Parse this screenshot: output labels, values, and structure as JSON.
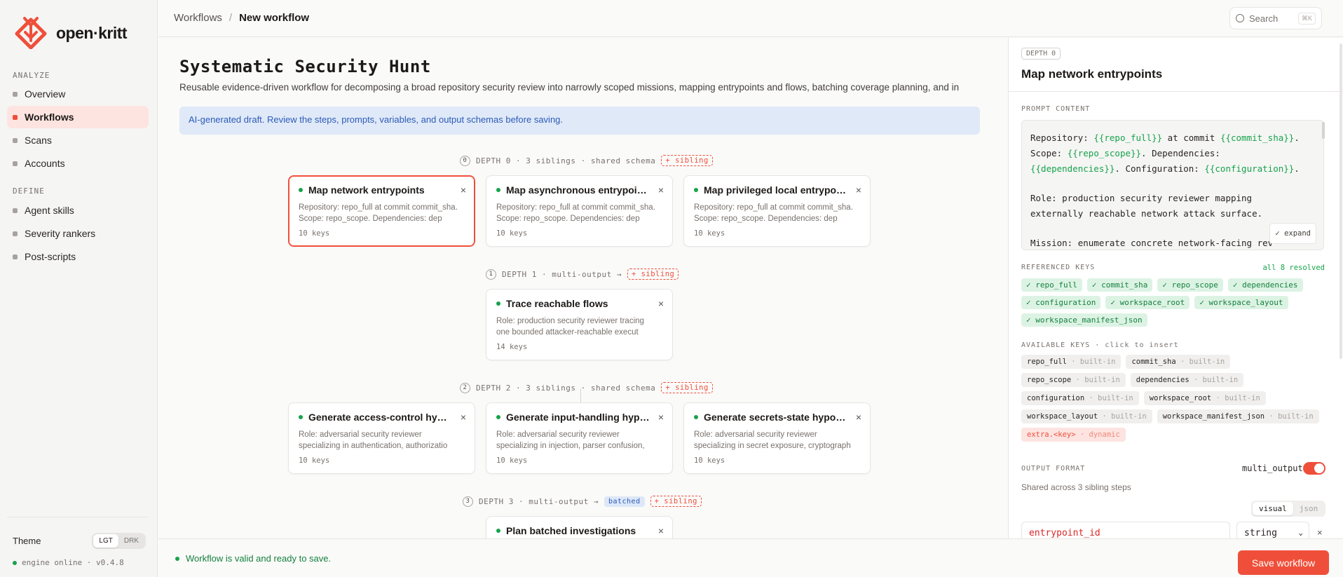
{
  "app": {
    "name": "open·kritt",
    "brand_color": "#ef4f3a"
  },
  "sidebar": {
    "analyze_label": "ANALYZE",
    "analyze_items": [
      {
        "label": "Overview"
      },
      {
        "label": "Workflows",
        "active": true
      },
      {
        "label": "Scans"
      },
      {
        "label": "Accounts"
      }
    ],
    "define_label": "DEFINE",
    "define_items": [
      {
        "label": "Agent skills"
      },
      {
        "label": "Severity rankers"
      },
      {
        "label": "Post-scripts"
      }
    ],
    "theme_label": "Theme",
    "theme_light": "LGT",
    "theme_dark": "DRK",
    "engine_status": "engine online · v0.4.8"
  },
  "topbar": {
    "breadcrumb_root": "Workflows",
    "breadcrumb_sep": "/",
    "breadcrumb_current": "New workflow",
    "search_placeholder": "Search",
    "search_shortcut": "⌘K"
  },
  "main": {
    "title": "Systematic Security Hunt",
    "subtitle": "Reusable evidence-driven workflow for decomposing a broad repository security review into narrowly scoped missions, mapping entrypoints and flows, batching coverage planning, and in",
    "banner": "AI-generated draft. Review the steps, prompts, variables, and output schemas before saving.",
    "depths": [
      {
        "num": "0",
        "label": "DEPTH 0 · 3 siblings · shared schema",
        "sibling": "+ sibling",
        "cards": [
          {
            "title": "Map network entrypoints",
            "desc1": "Repository: repo_full at commit commit_sha.",
            "desc2": "Scope: repo_scope. Dependencies: dep",
            "keys": "10 keys"
          },
          {
            "title": "Map asynchronous entrypoints",
            "desc1": "Repository: repo_full at commit commit_sha.",
            "desc2": "Scope: repo_scope. Dependencies: dep",
            "keys": "10 keys"
          },
          {
            "title": "Map privileged local entrypoin...",
            "desc1": "Repository: repo_full at commit commit_sha.",
            "desc2": "Scope: repo_scope. Dependencies: dep",
            "keys": "10 keys"
          }
        ]
      },
      {
        "num": "1",
        "label": "DEPTH 1 · multi-output →",
        "sibling": "+ sibling",
        "cards": [
          {
            "title": "Trace reachable flows",
            "desc1": "Role: production security reviewer tracing",
            "desc2": "one bounded attacker-reachable execut",
            "keys": "14 keys"
          }
        ]
      },
      {
        "num": "2",
        "label": "DEPTH 2 · 3 siblings · shared schema",
        "sibling": "+ sibling",
        "cards": [
          {
            "title": "Generate access-control hypo...",
            "desc1": "Role: adversarial security reviewer",
            "desc2": "specializing in authentication, authorizatio",
            "keys": "10 keys"
          },
          {
            "title": "Generate input-handling hypot...",
            "desc1": "Role: adversarial security reviewer",
            "desc2": "specializing in injection, parser confusion,",
            "keys": "10 keys"
          },
          {
            "title": "Generate secrets-state hypoth...",
            "desc1": "Role: adversarial security reviewer",
            "desc2": "specializing in secret exposure, cryptograph",
            "keys": "10 keys"
          }
        ]
      },
      {
        "num": "3",
        "label": "DEPTH 3 · multi-output →",
        "badge": "batched",
        "sibling": "+ sibling",
        "cards": [
          {
            "title": "Plan batched investigations"
          }
        ]
      }
    ]
  },
  "panel": {
    "depth": "DEPTH 0",
    "title": "Map network entrypoints",
    "prompt_label": "PROMPT CONTENT",
    "prompt": {
      "l1a": "Repository: ",
      "l1v1": "{{repo_full}}",
      "l1b": " at commit ",
      "l1v2": "{{commit_sha}}",
      "l1c": ".",
      "l2a": "Scope: ",
      "l2v1": "{{repo_scope}}",
      "l2b": ". Dependencies:",
      "l3v1": "{{dependencies}}",
      "l3a": ". Configuration: ",
      "l3v2": "{{configuration}}",
      "l3b": ".",
      "role1": "Role: production security reviewer mapping",
      "role2": "externally reachable network attack surface.",
      "mission": "Mission: enumerate concrete network-facing rev"
    },
    "expand": "✓ expand",
    "ref_label": "REFERENCED KEYS",
    "ref_status": "all 8 resolved",
    "ref_keys": [
      "✓ repo_full",
      "✓ commit_sha",
      "✓ repo_scope",
      "✓ dependencies",
      "✓ configuration",
      "✓ workspace_root",
      "✓ workspace_layout",
      "✓ workspace_manifest_json"
    ],
    "avail_label": "AVAILABLE KEYS · click to insert",
    "avail_keys": [
      {
        "name": "repo_full",
        "kind": "built-in"
      },
      {
        "name": "commit_sha",
        "kind": "built-in"
      },
      {
        "name": "repo_scope",
        "kind": "built-in"
      },
      {
        "name": "dependencies",
        "kind": "built-in"
      },
      {
        "name": "configuration",
        "kind": "built-in"
      },
      {
        "name": "workspace_root",
        "kind": "built-in"
      },
      {
        "name": "workspace_layout",
        "kind": "built-in"
      },
      {
        "name": "workspace_manifest_json",
        "kind": "built-in"
      }
    ],
    "dynamic_key": {
      "name": "extra.<key>",
      "kind": "dynamic"
    },
    "output_label": "OUTPUT FORMAT",
    "multi_output_label": "multi_output",
    "multi_output_on": true,
    "shared_text": "Shared across 3 sibling steps",
    "view_visual": "visual",
    "view_json": "json",
    "field_name": "entrypoint_id",
    "field_type": "string"
  },
  "footer": {
    "valid_text": "Workflow is valid and ready to save.",
    "save_label": "Save workflow"
  }
}
